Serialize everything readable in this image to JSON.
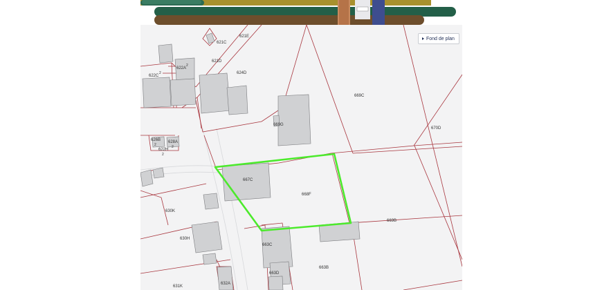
{
  "map": {
    "base_map_button": "Fond de plan",
    "selected_parcel": "668F",
    "colors": {
      "selection": "#4cea2c",
      "parcel_line": "#a8353d",
      "building_fill": "#d0d1d3",
      "background": "#f3f3f4"
    },
    "parcels": [
      {
        "id": "621E",
        "label": "621E"
      },
      {
        "id": "621C",
        "label": "621C"
      },
      {
        "id": "621D",
        "label": "621D"
      },
      {
        "id": "624D",
        "label": "624D"
      },
      {
        "id": "622C",
        "label": "622C",
        "sup": "2"
      },
      {
        "id": "622A",
        "label": "622A",
        "sup": "2"
      },
      {
        "id": "669C",
        "label": "669C"
      },
      {
        "id": "670D",
        "label": "670D"
      },
      {
        "id": "669G",
        "label": "669G"
      },
      {
        "id": "626B",
        "label": "626B",
        "sup": "2"
      },
      {
        "id": "628A",
        "label": "628A",
        "sup": "2"
      },
      {
        "id": "622H",
        "label": "622H",
        "sup": "2"
      },
      {
        "id": "667C",
        "label": "667C"
      },
      {
        "id": "668F",
        "label": "668F"
      },
      {
        "id": "630K",
        "label": "630K"
      },
      {
        "id": "669B",
        "label": "669B"
      },
      {
        "id": "630H",
        "label": "630H"
      },
      {
        "id": "663C",
        "label": "663C"
      },
      {
        "id": "663D",
        "label": "663D"
      },
      {
        "id": "663B",
        "label": "663B"
      },
      {
        "id": "631K",
        "label": "631K"
      },
      {
        "id": "632A",
        "label": "632A"
      }
    ]
  }
}
